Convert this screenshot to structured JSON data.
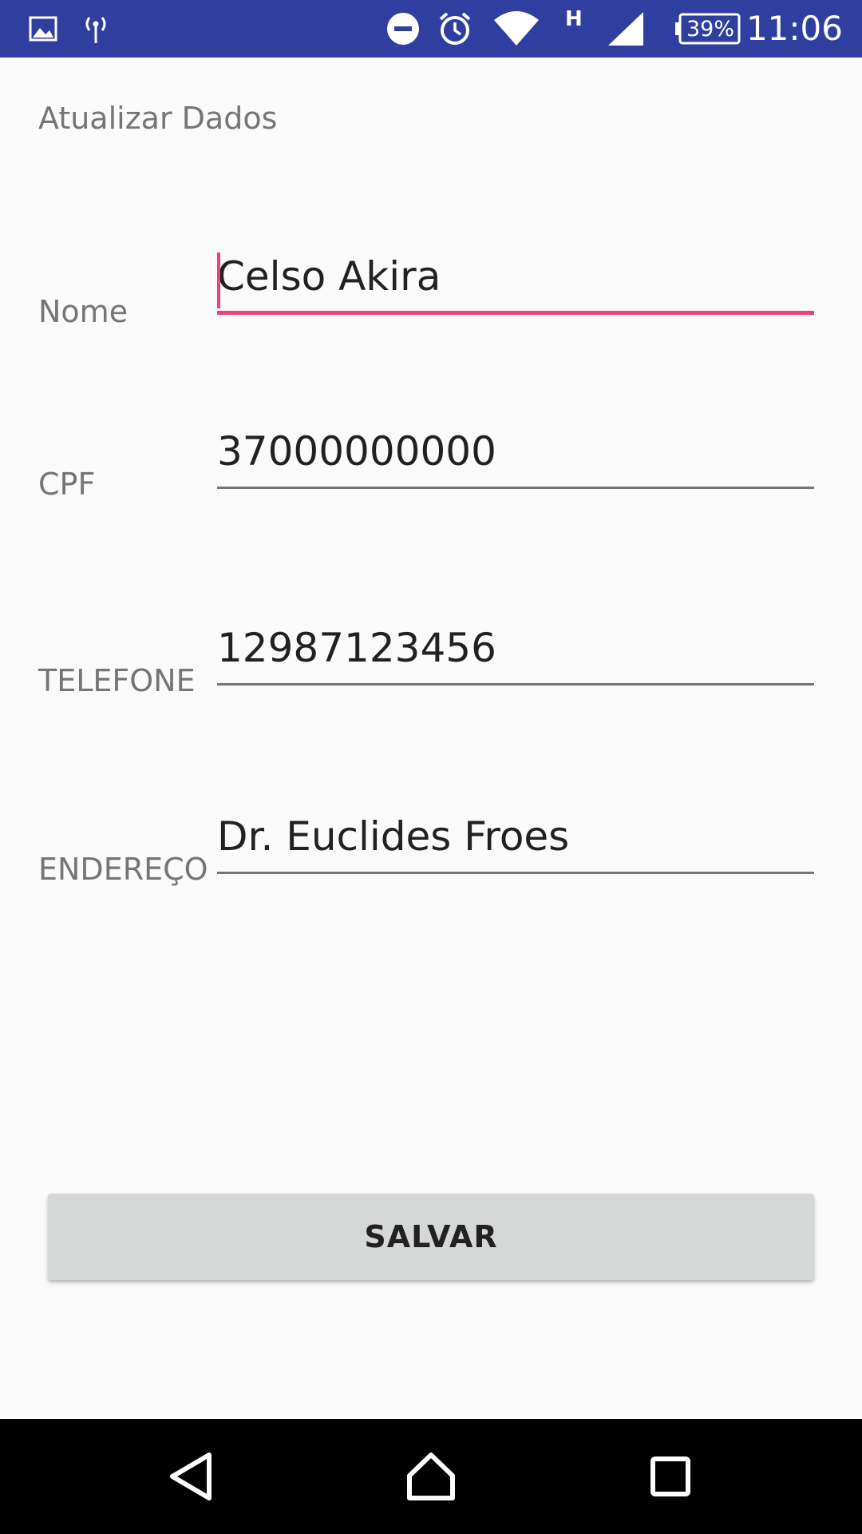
{
  "status_bar": {
    "icons": [
      "image-icon",
      "hotspot-icon",
      "do-not-disturb-icon",
      "alarm-icon",
      "wifi-icon",
      "signal-icon",
      "battery-icon"
    ],
    "network_type": "H",
    "battery": "39%",
    "time": "11:06"
  },
  "page": {
    "title": "Atualizar Dados"
  },
  "form": {
    "nome": {
      "label": "Nome",
      "value": "Celso Akira"
    },
    "cpf": {
      "label": "CPF",
      "value": "37000000000"
    },
    "telefone": {
      "label": "TELEFONE",
      "value": "12987123456"
    },
    "endereco": {
      "label": "ENDEREÇO",
      "value": "Dr. Euclides Froes"
    }
  },
  "actions": {
    "save_label": "SALVAR"
  },
  "nav_bar": {
    "buttons": [
      "back-icon",
      "home-icon",
      "recents-icon"
    ]
  },
  "colors": {
    "status_bar": "#303f9f",
    "accent": "#ec407a",
    "background": "#fafafa",
    "button": "#d6d7d7"
  }
}
